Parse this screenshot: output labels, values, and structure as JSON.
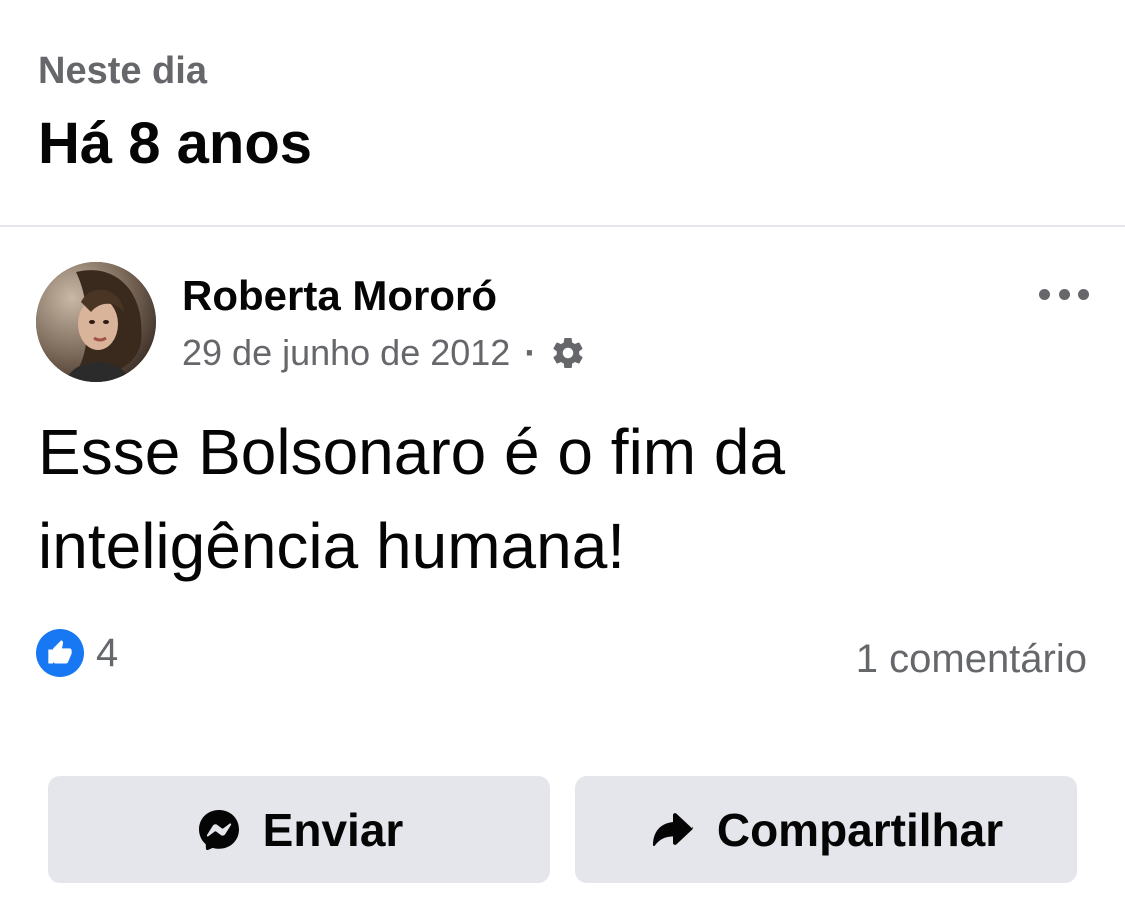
{
  "header": {
    "subtitle": "Neste dia",
    "title": "Há 8 anos"
  },
  "post": {
    "author": "Roberta Mororó",
    "date": "29 de junho de 2012",
    "separator": "·",
    "privacy_icon": "gear-icon",
    "more_icon": "more-options-icon",
    "text": "Esse Bolsonaro é o fim da inteligência humana!",
    "reactions": {
      "icon": "like-icon",
      "count": "4"
    },
    "comments_label": "1 comentário"
  },
  "actions": {
    "send_label": "Enviar",
    "send_icon": "messenger-icon",
    "share_label": "Compartilhar",
    "share_icon": "share-arrow-icon"
  },
  "colors": {
    "accent": "#1877f2",
    "secondary_text": "#65676b",
    "button_bg": "#e4e6eb"
  }
}
